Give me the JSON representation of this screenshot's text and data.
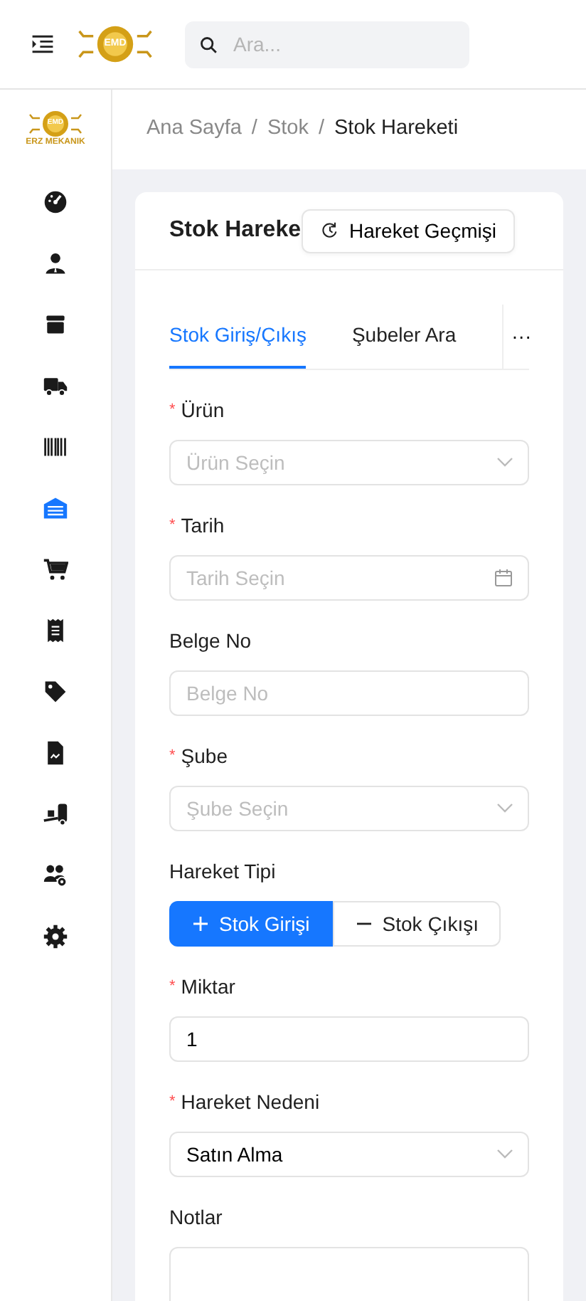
{
  "header": {
    "logo_initials": "EMD",
    "search": {
      "placeholder": "Ara..."
    }
  },
  "sidebar": {
    "logo": {
      "initials": "EMD",
      "brand": "ERZ MEKANIK"
    },
    "items": [
      {
        "kind": "gauge",
        "selected": false
      },
      {
        "kind": "user",
        "selected": false
      },
      {
        "kind": "box",
        "selected": false
      },
      {
        "kind": "truck",
        "selected": false
      },
      {
        "kind": "barcode",
        "selected": false
      },
      {
        "kind": "warehouse",
        "selected": true
      },
      {
        "kind": "cart",
        "selected": false
      },
      {
        "kind": "receipt",
        "selected": false
      },
      {
        "kind": "tag",
        "selected": false
      },
      {
        "kind": "document",
        "selected": false
      },
      {
        "kind": "forklift",
        "selected": false
      },
      {
        "kind": "users-gear",
        "selected": false
      },
      {
        "kind": "gear",
        "selected": false
      }
    ]
  },
  "breadcrumb": {
    "separator": "/",
    "items": [
      "Ana Sayfa",
      "Stok",
      "Stok Hareketi"
    ]
  },
  "card": {
    "title": "Stok Hareke",
    "history_button": "Hareket Geçmişi",
    "tabs": [
      {
        "label": "Stok Giriş/Çıkış",
        "selected": true
      },
      {
        "label": "Şubeler Ara",
        "selected": false
      }
    ],
    "more": "···",
    "fields": [
      {
        "kind": "select",
        "label": "Ürün",
        "required_mark": "*",
        "placeholder": "Ürün Seçin"
      },
      {
        "kind": "date",
        "label": "Tarih",
        "required_mark": "*",
        "placeholder": "Tarih Seçin"
      },
      {
        "kind": "text",
        "label": "Belge No",
        "placeholder": "Belge No"
      },
      {
        "kind": "select",
        "label": "Şube",
        "required_mark": "*",
        "placeholder": "Şube Seçin"
      },
      {
        "kind": "segmented",
        "label": "Hareket Tipi",
        "options": [
          {
            "label": "Stok Girişi",
            "kind": "plus",
            "selected": true
          },
          {
            "label": "Stok Çıkışı",
            "kind": "minus",
            "selected": false
          }
        ]
      },
      {
        "kind": "text",
        "label": "Miktar",
        "required_mark": "*",
        "value": "1"
      },
      {
        "kind": "select",
        "label": "Hareket Nedeni",
        "required_mark": "*",
        "value": "Satın Alma"
      },
      {
        "kind": "textarea",
        "label": "Notlar"
      }
    ]
  }
}
